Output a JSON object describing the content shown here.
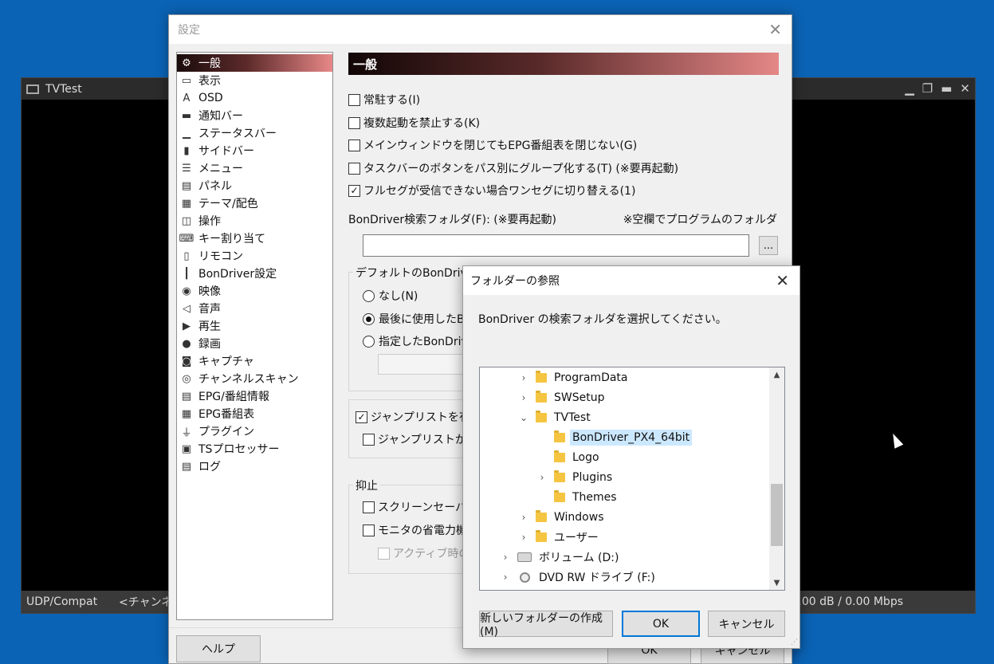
{
  "tvtest": {
    "title": "TVTest",
    "controls": [
      "▁",
      "❐",
      "▬",
      "✕"
    ],
    "status": {
      "left": "UDP/Compat",
      "channel": "<チャンネル",
      "right": ".00 dB / 0.00 Mbps"
    }
  },
  "settings": {
    "title": "設定",
    "close": "✕",
    "categories": [
      {
        "label": "一般",
        "icon": "gear-icon",
        "glyph": "⚙"
      },
      {
        "label": "表示",
        "icon": "display-icon",
        "glyph": "▭"
      },
      {
        "label": "OSD",
        "icon": "osd-icon",
        "glyph": "A"
      },
      {
        "label": "通知バー",
        "icon": "notification-bar-icon",
        "glyph": "▬"
      },
      {
        "label": "ステータスバー",
        "icon": "statusbar-icon",
        "glyph": "▁"
      },
      {
        "label": "サイドバー",
        "icon": "sidebar-icon",
        "glyph": "▮"
      },
      {
        "label": "メニュー",
        "icon": "menu-icon",
        "glyph": "☰"
      },
      {
        "label": "パネル",
        "icon": "panel-icon",
        "glyph": "▤"
      },
      {
        "label": "テーマ/配色",
        "icon": "theme-icon",
        "glyph": "▦"
      },
      {
        "label": "操作",
        "icon": "mouse-icon",
        "glyph": "◫"
      },
      {
        "label": "キー割り当て",
        "icon": "keyboard-icon",
        "glyph": "⌨"
      },
      {
        "label": "リモコン",
        "icon": "remote-icon",
        "glyph": "▯"
      },
      {
        "label": "BonDriver設定",
        "icon": "bondriver-icon",
        "glyph": "┃"
      },
      {
        "label": "映像",
        "icon": "video-icon",
        "glyph": "◉"
      },
      {
        "label": "音声",
        "icon": "speaker-icon",
        "glyph": "◁"
      },
      {
        "label": "再生",
        "icon": "play-icon",
        "glyph": "▶"
      },
      {
        "label": "録画",
        "icon": "record-icon",
        "glyph": "●"
      },
      {
        "label": "キャプチャ",
        "icon": "camera-icon",
        "glyph": "◙"
      },
      {
        "label": "チャンネルスキャン",
        "icon": "scan-icon",
        "glyph": "◎"
      },
      {
        "label": "EPG/番組情報",
        "icon": "epg-info-icon",
        "glyph": "▤"
      },
      {
        "label": "EPG番組表",
        "icon": "epg-table-icon",
        "glyph": "▦"
      },
      {
        "label": "プラグイン",
        "icon": "plugin-icon",
        "glyph": "⏚"
      },
      {
        "label": "TSプロセッサー",
        "icon": "ts-processor-icon",
        "glyph": "▣"
      },
      {
        "label": "ログ",
        "icon": "log-icon",
        "glyph": "▤"
      }
    ],
    "section_title": "一般",
    "options": {
      "resident": "常駐する(I)",
      "no_multiple": "複数起動を禁止する(K)",
      "keep_epg": "メインウィンドウを閉じてもEPG番組表を閉じない(G)",
      "group_taskbar": "タスクバーのボタンをパス別にグループ化する(T) (※要再起動)",
      "oneseg_switch": "フルセグが受信できない場合ワンセグに切り替える(1)"
    },
    "bon_folder_label": "BonDriver検索フォルダ(F): (※要再起動)",
    "bon_folder_note": "※空欄でプログラムのフォルダ",
    "browse_label": "...",
    "default_bon_group": "デフォルトのBonDriver",
    "radio_none": "なし(N)",
    "radio_last": "最後に使用したB",
    "radio_specified": "指定したBonDriv",
    "jumplist_enable": "ジャンプリストを有効",
    "jumplist_from": "ジャンプリストから複",
    "suppress_group": "抑止",
    "screensaver": "スクリーンセーバーを",
    "monitor_power": "モニタの省電力機",
    "active_only": "アクティブ時のみ",
    "help_label": "ヘルプ",
    "ok_label": "OK",
    "cancel_label": "キャンセル"
  },
  "browse": {
    "title": "フォルダーの参照",
    "close": "✕",
    "prompt": "BonDriver の検索フォルダを選択してください。",
    "tree": [
      {
        "label": "ProgramData",
        "expander": "›",
        "type": "folder"
      },
      {
        "label": "SWSetup",
        "expander": "›",
        "type": "folder"
      },
      {
        "label": "TVTest",
        "expander": "⌄",
        "type": "folder"
      },
      {
        "label": "BonDriver_PX4_64bit",
        "expander": "",
        "type": "folder",
        "selected": true
      },
      {
        "label": "Logo",
        "expander": "",
        "type": "folder"
      },
      {
        "label": "Plugins",
        "expander": "›",
        "type": "folder"
      },
      {
        "label": "Themes",
        "expander": "",
        "type": "folder"
      },
      {
        "label": "Windows",
        "expander": "›",
        "type": "folder"
      },
      {
        "label": "ユーザー",
        "expander": "›",
        "type": "folder"
      },
      {
        "label": "ボリューム (D:)",
        "expander": "›",
        "type": "drive"
      },
      {
        "label": "DVD RW ドライブ (F:)",
        "expander": "›",
        "type": "dvd"
      }
    ],
    "scroll_up": "▲",
    "scroll_down": "▼",
    "new_folder": "新しいフォルダーの作成(M)",
    "ok": "OK",
    "cancel": "キャンセル",
    "grip": "⋰"
  }
}
